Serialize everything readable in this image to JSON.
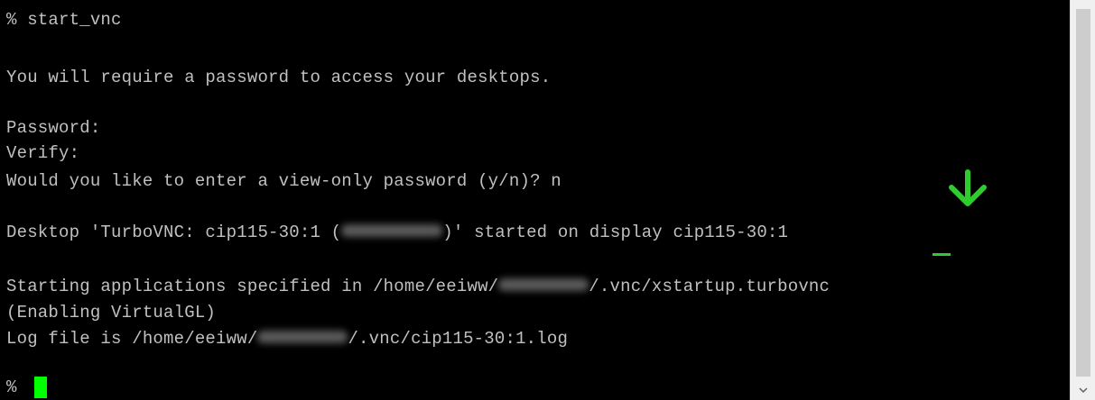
{
  "terminal": {
    "lines": {
      "cmd": "% start_vnc",
      "msg": "You will require a password to access your desktops.",
      "password": "Password:",
      "verify": "Verify:",
      "viewonly": "Would you like to enter a view-only password (y/n)? n",
      "desktop_pre": "Desktop 'TurboVNC: cip115-30:1 (",
      "desktop_post": ")' started on display cip115-30:1",
      "starting_pre": "Starting applications specified in /home/eeiww/",
      "starting_post": "/.vnc/xstartup.turbovnc",
      "virtualgl": "(Enabling VirtualGL)",
      "log_pre": "Log file is /home/eeiww/",
      "log_post": "/.vnc/cip115-30:1.log",
      "prompt": "%"
    },
    "colors": {
      "background": "#000000",
      "text": "#c0c0c0",
      "cursor": "#00ff00",
      "annotation": "#2ecc2e"
    }
  },
  "annotations": {
    "arrow_icon": "down-arrow-icon"
  },
  "scrollbar": {
    "down_icon": "chevron-down-icon"
  }
}
